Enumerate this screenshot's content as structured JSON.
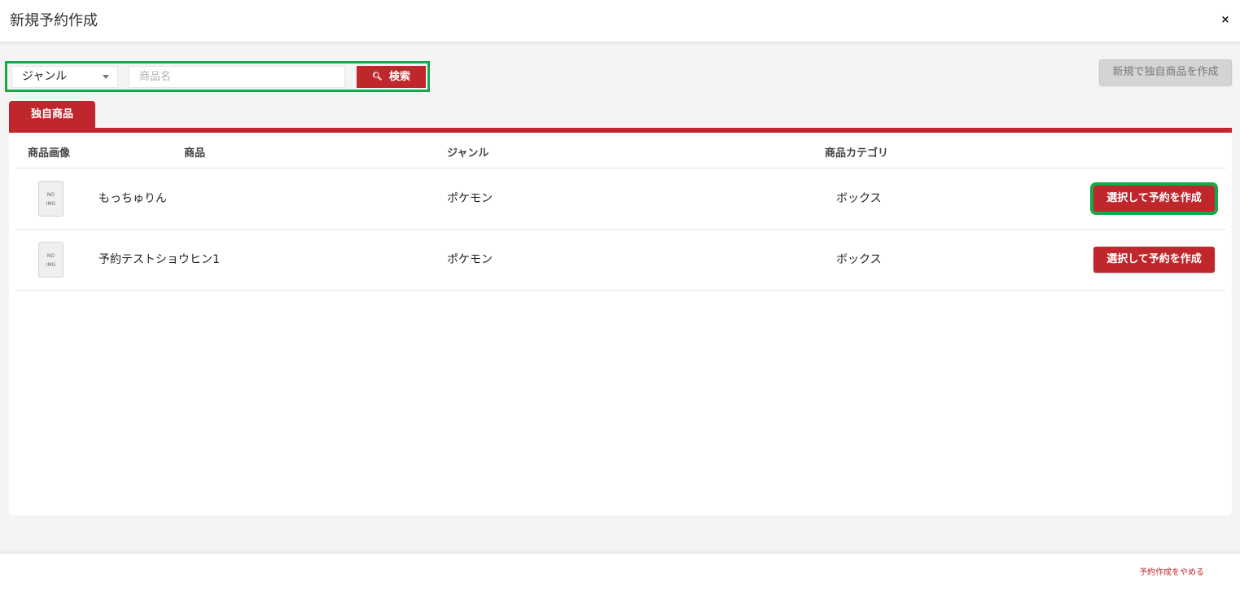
{
  "header": {
    "title": "新規予約作成",
    "close_label": "×"
  },
  "search": {
    "genre_value": "ジャンル",
    "name_placeholder": "商品名",
    "search_label": "検索",
    "search_icon": "magnifier-icon"
  },
  "create_own_label": "新規で独自商品を作成",
  "tabs": [
    {
      "label": "独自商品",
      "active": true
    }
  ],
  "table": {
    "headers": [
      "商品画像",
      "商品",
      "ジャンル",
      "商品カテゴリ"
    ],
    "rows": [
      {
        "image_text": [
          "NO",
          "IMG"
        ],
        "product": "もっちゅりん",
        "genre": "ポケモン",
        "category": "ボックス",
        "action": "選択して予約を作成"
      },
      {
        "image_text": [
          "NO",
          "IMG"
        ],
        "product": "予約テストショウヒン1",
        "genre": "ポケモン",
        "category": "ボックス",
        "action": "選択して予約を作成"
      }
    ]
  },
  "footer": {
    "cancel_label": "予約作成をやめる"
  },
  "colors": {
    "accent": "#c0272d",
    "highlight": "#15a94a",
    "background": "#f4f4f4"
  }
}
